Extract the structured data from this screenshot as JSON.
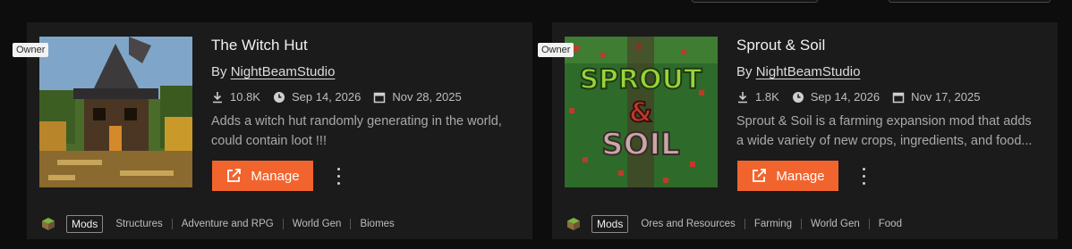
{
  "cards": [
    {
      "title": "The Witch Hut",
      "by_label": "By",
      "author": "NightBeamStudio",
      "owner_badge": "Owner",
      "downloads": "10.8K",
      "updated": "Sep 14, 2026",
      "created": "Nov 28, 2025",
      "description": [
        "Adds a witch hut randomly generating in the world,",
        "could contain loot !!!"
      ],
      "manage_label": "Manage",
      "primary_tag": "Mods",
      "tags": [
        "Structures",
        "Adventure and RPG",
        "World Gen",
        "Biomes"
      ]
    },
    {
      "title": "Sprout & Soil",
      "by_label": "By",
      "author": "NightBeamStudio",
      "owner_badge": "Owner",
      "downloads": "1.8K",
      "updated": "Sep 14, 2026",
      "created": "Nov 17, 2025",
      "description": [
        "Sprout & Soil is a farming expansion mod that adds",
        "a wide variety of new crops, ingredients, and food..."
      ],
      "manage_label": "Manage",
      "primary_tag": "Mods",
      "tags": [
        "Ores and Resources",
        "Farming",
        "World Gen",
        "Food"
      ],
      "logo_text": [
        "SPROUT",
        "&",
        "SOIL"
      ]
    }
  ],
  "colors": {
    "accent": "#f2642d",
    "card_bg": "#1b1b1b",
    "page_bg": "#0d0d0d"
  },
  "icons": {
    "downloads": "download-icon",
    "updated": "clock-icon",
    "created": "calendar-icon",
    "manage": "external-link-icon",
    "more": "kebab-menu-icon",
    "category": "grass-block-icon"
  }
}
